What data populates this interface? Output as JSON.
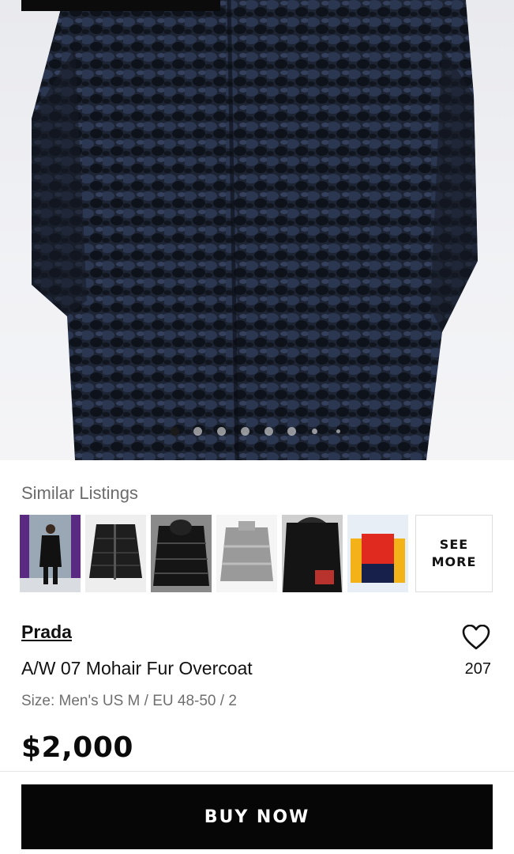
{
  "hero": {
    "image_icon": "fur-overcoat-photo",
    "dots_total": 8,
    "active_dot": 0
  },
  "similar": {
    "title": "Similar Listings",
    "thumbnails": [
      {
        "icon": "runway-coat-photo"
      },
      {
        "icon": "quilted-puffer-photo"
      },
      {
        "icon": "leather-puffer-photo"
      },
      {
        "icon": "grey-cropped-puffer-photo"
      },
      {
        "icon": "black-hooded-jacket-photo"
      },
      {
        "icon": "colorblock-vest-photo"
      }
    ],
    "see_more_label": "SEE\nMORE"
  },
  "product": {
    "brand": "Prada",
    "title": "A/W 07 Mohair Fur Overcoat",
    "size": "Size: Men's US M / EU 48-50 / 2",
    "price": "$2,000",
    "likes": "207"
  },
  "actions": {
    "buy_label": "BUY NOW"
  },
  "colors": {
    "accent": "#060606",
    "muted": "#6f6f6f"
  }
}
